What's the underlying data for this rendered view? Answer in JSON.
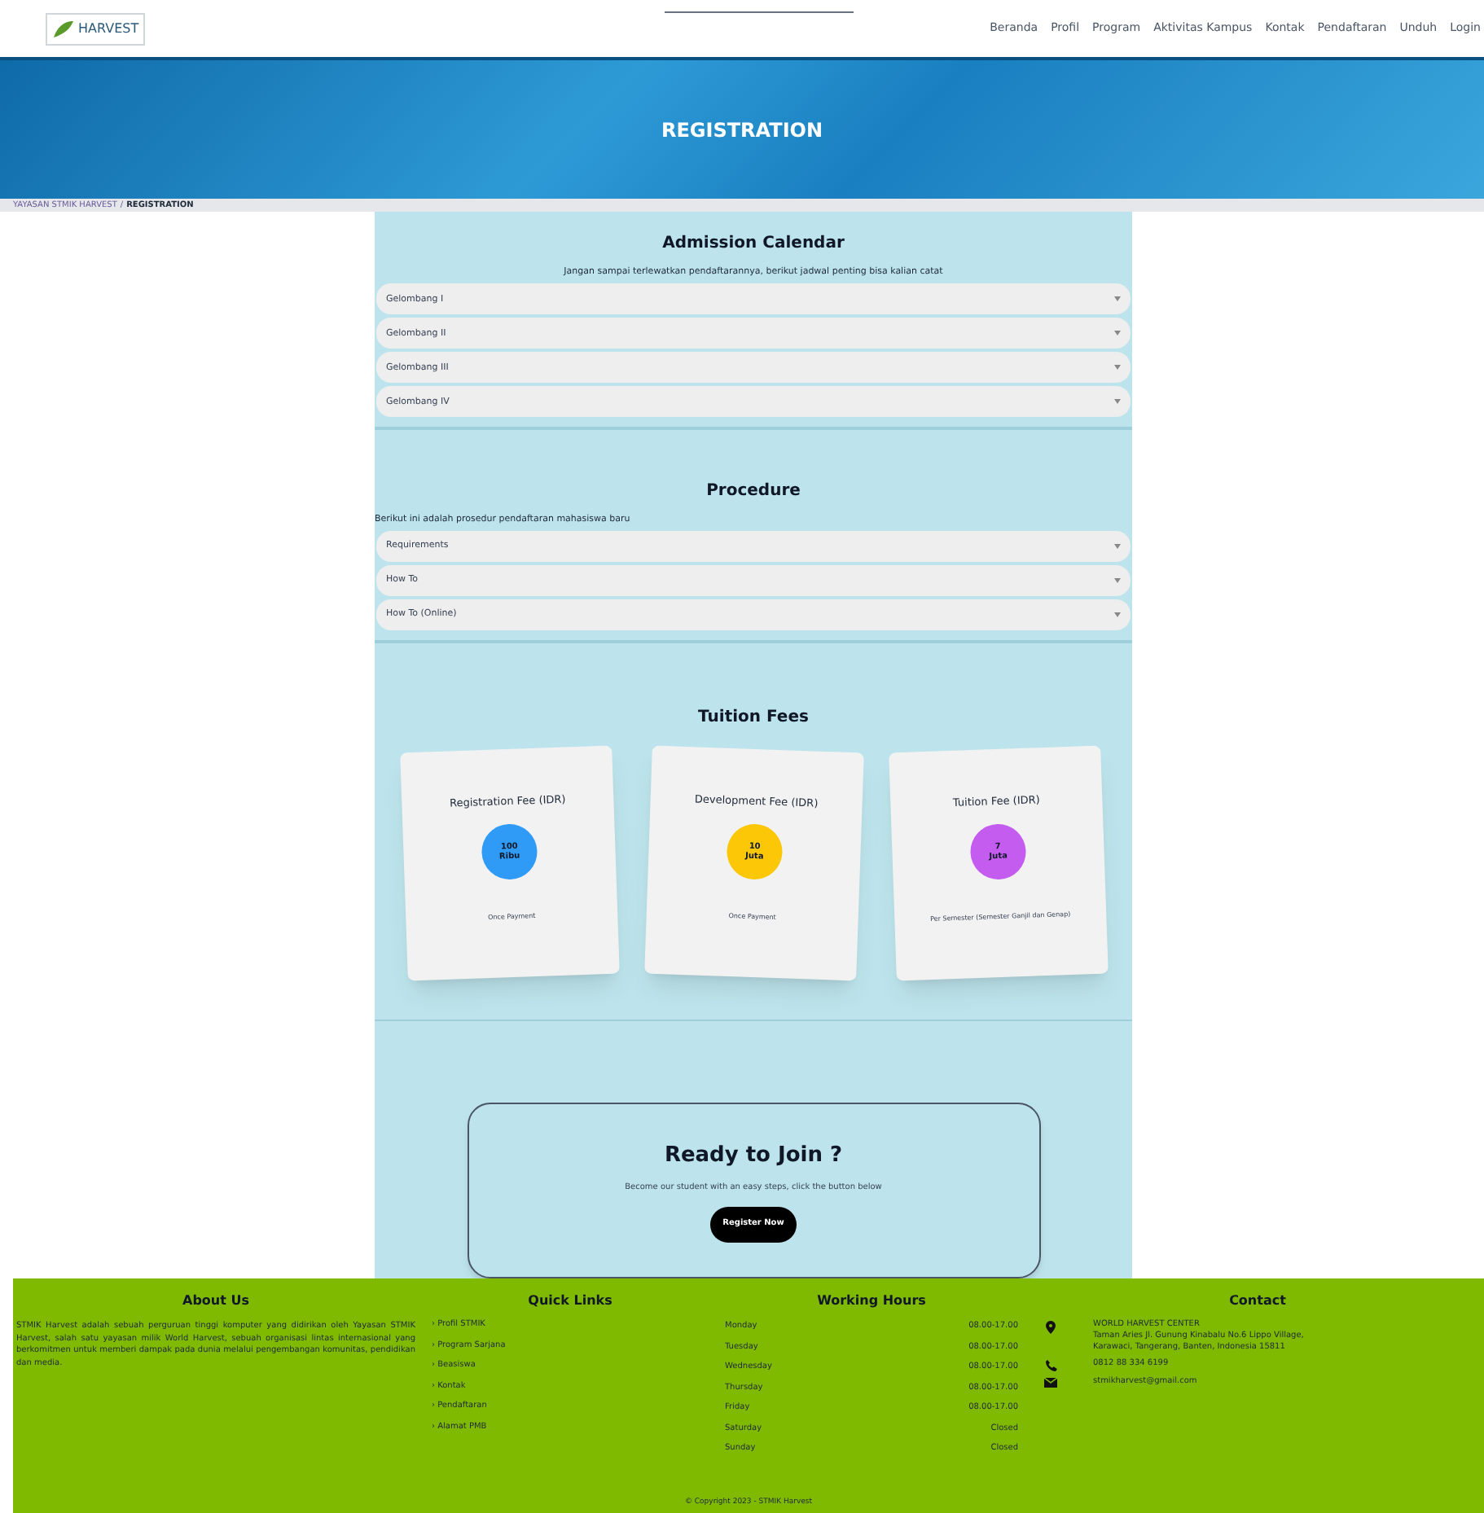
{
  "nav": {
    "logo": "HARVEST",
    "items": [
      {
        "label": "Beranda"
      },
      {
        "label": "Profil"
      },
      {
        "label": "Program"
      },
      {
        "label": "Aktivitas Kampus"
      },
      {
        "label": "Kontak"
      },
      {
        "label": "Pendaftaran"
      },
      {
        "label": "Unduh"
      },
      {
        "label": "Login"
      }
    ]
  },
  "banner": {
    "title": "REGISTRATION"
  },
  "breadcrumb": [
    "YAYASAN STMIK HARVEST",
    "/",
    "REGISTRATION"
  ],
  "admission": {
    "title": "Admission Calendar",
    "subtitle": "Jangan sampai terlewatkan pendaftarannya, berikut jadwal penting bisa kalian catat",
    "items": [
      {
        "label": "Gelombang I",
        "expanded": false
      },
      {
        "label": "Gelombang II",
        "expanded": false
      },
      {
        "label": "Gelombang III",
        "expanded": false
      },
      {
        "label": "Gelombang IV",
        "expanded": false
      }
    ]
  },
  "procedure": {
    "title": "Procedure",
    "subtitle": "Berikut ini adalah prosedur pendaftaran mahasiswa baru",
    "items": [
      {
        "label": "Requirements",
        "expanded": false
      },
      {
        "label": "How To",
        "expanded": false
      },
      {
        "label": "How To (Online)",
        "expanded": false
      }
    ]
  },
  "fees": {
    "title": "Tuition Fees",
    "cards": [
      {
        "title": "Registration Fee (IDR)",
        "amount": "100",
        "unit": "Ribu",
        "note": "Once Payment",
        "color": "#2f9bf7"
      },
      {
        "title": "Development Fee (IDR)",
        "amount": "10",
        "unit": "Juta",
        "note": "Once Payment",
        "color": "#fbc707"
      },
      {
        "title": "Tuition Fee (IDR)",
        "amount": "7",
        "unit": "Juta",
        "note": "Per Semester (Semester Ganjil dan Genap)",
        "color": "#c45cf0"
      }
    ]
  },
  "cta": {
    "title": "Ready to Join ?",
    "subtitle": "Become our student with an easy steps, click the button below",
    "button": "Register Now"
  },
  "footer": {
    "about": {
      "title": "About Us",
      "text": "STMIK Harvest adalah sebuah perguruan tinggi komputer yang didirikan oleh Yayasan STMIK Harvest, salah satu yayasan milik World Harvest, sebuah organisasi lintas internasional yang berkomitmen untuk memberi dampak pada dunia melalui pengembangan komunitas, pendidikan dan media."
    },
    "links": {
      "title": "Quick Links",
      "items": [
        "› Profil STMIK",
        "› Program Sarjana",
        "› Beasiswa",
        "› Kontak",
        "› Pendaftaran",
        "› Alamat PMB"
      ]
    },
    "hours": {
      "title": "Working Hours",
      "rows": [
        {
          "day": "Monday",
          "time": "08.00-17.00"
        },
        {
          "day": "Tuesday",
          "time": "08.00-17.00"
        },
        {
          "day": "Wednesday",
          "time": "08.00-17.00"
        },
        {
          "day": "Thursday",
          "time": "08.00-17.00"
        },
        {
          "day": "Friday",
          "time": "08.00-17.00"
        },
        {
          "day": "Saturday",
          "time": "Closed"
        },
        {
          "day": "Sunday",
          "time": "Closed"
        }
      ]
    },
    "contact": {
      "title": "Contact",
      "items": [
        {
          "kind": "pin",
          "lines": [
            "WORLD HARVEST CENTER",
            "Taman Aries Jl. Gunung Kinabalu No.6 Lippo Village,",
            "Karawaci, Tangerang, Banten, Indonesia 15811"
          ]
        },
        {
          "kind": "phone",
          "lines": [
            "0812 88 334 6199"
          ]
        },
        {
          "kind": "mail",
          "lines": [
            "stmikharvest@gmail.com"
          ]
        }
      ]
    },
    "copyright": "© Copyright 2023 - STMIK Harvest"
  }
}
